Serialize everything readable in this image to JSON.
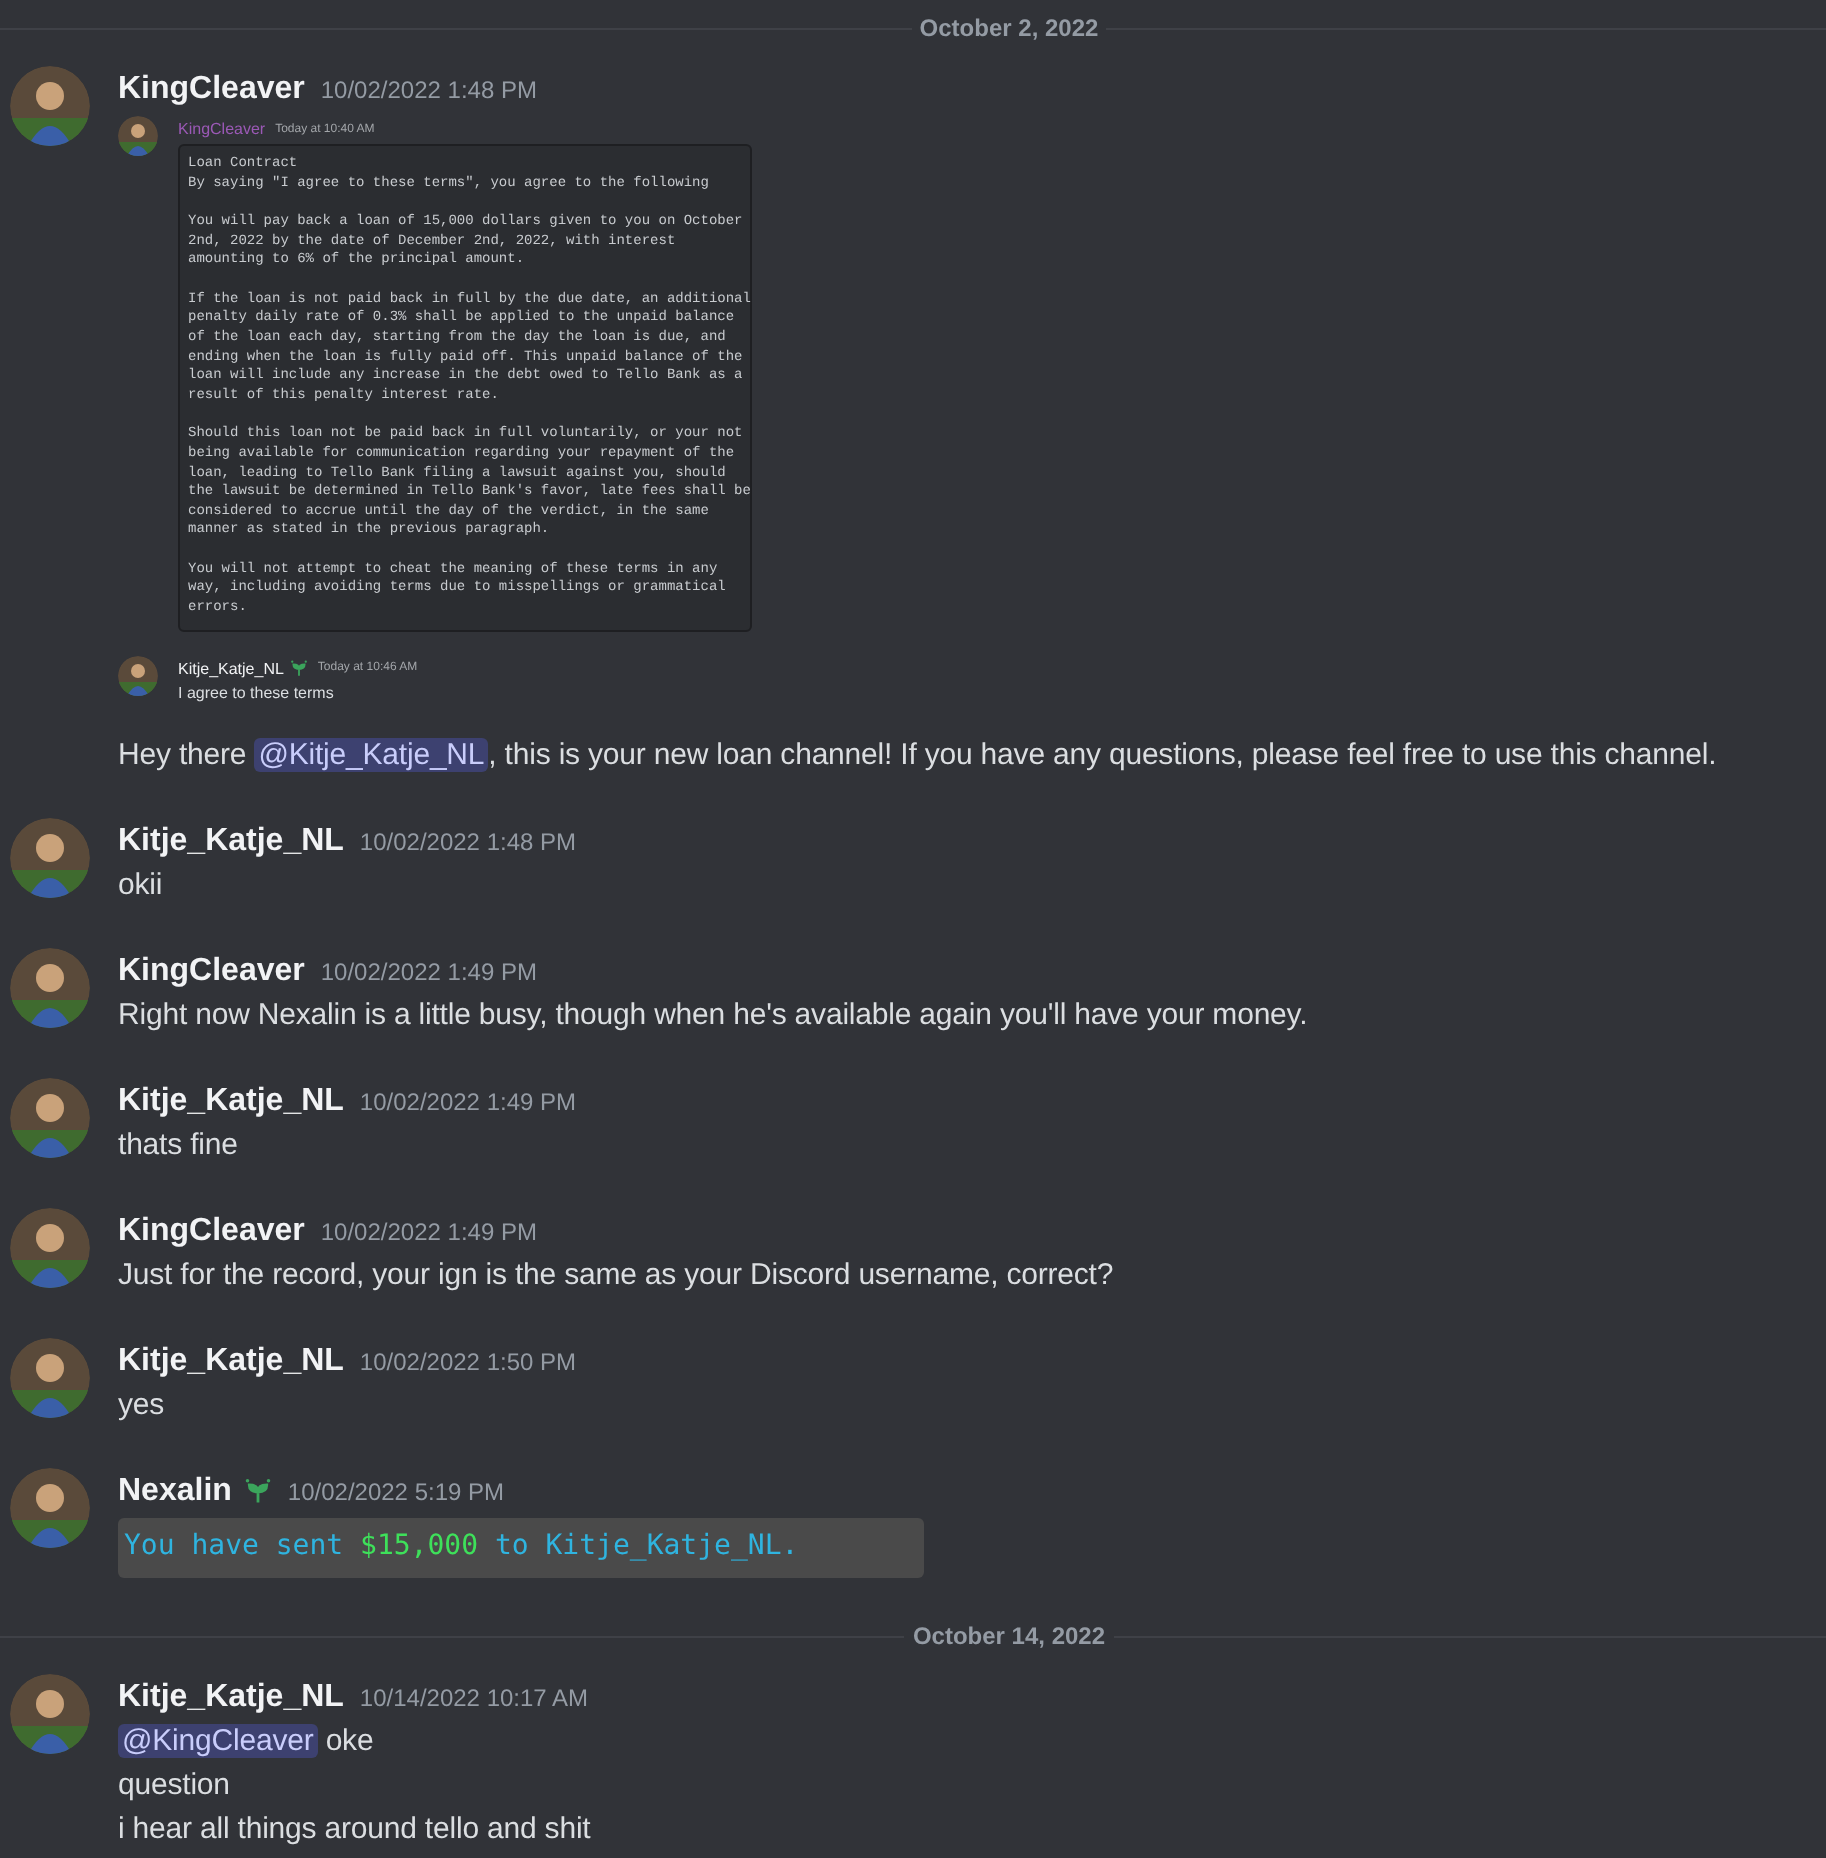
{
  "channel": [
    {
      "kind": "divider",
      "label": "October 2, 2022"
    },
    {
      "kind": "message",
      "author": "KingCleaver",
      "time": "10/02/2022 1:48 PM",
      "badge": false,
      "screenshot": {
        "messages": [
          {
            "author": "KingCleaver",
            "time": "Today at 10:40 AM",
            "badge": false,
            "code": "Loan Contract\nBy saying \"I agree to these terms\", you agree to the following\n\nYou will pay back a loan of 15,000 dollars given to you on October\n2nd, 2022 by the date of December 2nd, 2022, with interest\namounting to 6% of the principal amount.\n\nIf the loan is not paid back in full by the due date, an additional\npenalty daily rate of 0.3% shall be applied to the unpaid balance\nof the loan each day, starting from the day the loan is due, and\nending when the loan is fully paid off. This unpaid balance of the\nloan will include any increase in the debt owed to Tello Bank as a\nresult of this penalty interest rate.\n\nShould this loan not be paid back in full voluntarily, or your not\nbeing available for communication regarding your repayment of the\nloan, leading to Tello Bank filing a lawsuit against you, should\nthe lawsuit be determined in Tello Bank's favor, late fees shall be\nconsidered to accrue until the day of the verdict, in the same\nmanner as stated in the previous paragraph.\n\nYou will not attempt to cheat the meaning of these terms in any\nway, including avoiding terms due to misspellings or grammatical\nerrors."
          },
          {
            "author": "Kitje_Katje_NL",
            "time": "Today at 10:46 AM",
            "badge": true,
            "text": "I agree to these terms"
          }
        ]
      },
      "lines": [
        [
          {
            "kind": "text",
            "text": "Hey there "
          },
          {
            "kind": "mention",
            "text": "@Kitje_Katje_NL"
          },
          {
            "kind": "text",
            "text": ", this is your new loan channel! If you have any questions, please feel free to use this channel."
          }
        ]
      ]
    },
    {
      "kind": "message",
      "author": "Kitje_Katje_NL",
      "time": "10/02/2022 1:48 PM",
      "badge": false,
      "lines": [
        [
          {
            "kind": "text",
            "text": "okii"
          }
        ]
      ]
    },
    {
      "kind": "message",
      "author": "KingCleaver",
      "time": "10/02/2022 1:49 PM",
      "badge": false,
      "lines": [
        [
          {
            "kind": "text",
            "text": "Right now Nexalin is a little busy, though when he's available again you'll have your money."
          }
        ]
      ]
    },
    {
      "kind": "message",
      "author": "Kitje_Katje_NL",
      "time": "10/02/2022 1:49 PM",
      "badge": false,
      "lines": [
        [
          {
            "kind": "text",
            "text": "thats fine"
          }
        ]
      ]
    },
    {
      "kind": "message",
      "author": "KingCleaver",
      "time": "10/02/2022 1:49 PM",
      "badge": false,
      "lines": [
        [
          {
            "kind": "text",
            "text": "Just for the record, your ign is the same as your Discord username, correct?"
          }
        ]
      ]
    },
    {
      "kind": "message",
      "author": "Kitje_Katje_NL",
      "time": "10/02/2022 1:50 PM",
      "badge": false,
      "lines": [
        [
          {
            "kind": "text",
            "text": "yes"
          }
        ]
      ]
    },
    {
      "kind": "message",
      "author": "Nexalin",
      "time": "10/02/2022 5:19 PM",
      "badge": true,
      "game_chat": [
        {
          "text": "You have sent ",
          "kind": "text"
        },
        {
          "text": "$15,000",
          "kind": "money"
        },
        {
          "text": " to Kitje_Katje_NL.",
          "kind": "text"
        }
      ]
    },
    {
      "kind": "divider",
      "label": "October 14, 2022"
    },
    {
      "kind": "message",
      "author": "Kitje_Katje_NL",
      "time": "10/14/2022 10:17 AM",
      "badge": false,
      "lines": [
        [
          {
            "kind": "mention",
            "text": "@KingCleaver"
          },
          {
            "kind": "text",
            "text": " oke"
          }
        ],
        [
          {
            "kind": "text",
            "text": "question"
          }
        ],
        [
          {
            "kind": "text",
            "text": "i hear all things around tello and shit"
          }
        ]
      ]
    }
  ]
}
